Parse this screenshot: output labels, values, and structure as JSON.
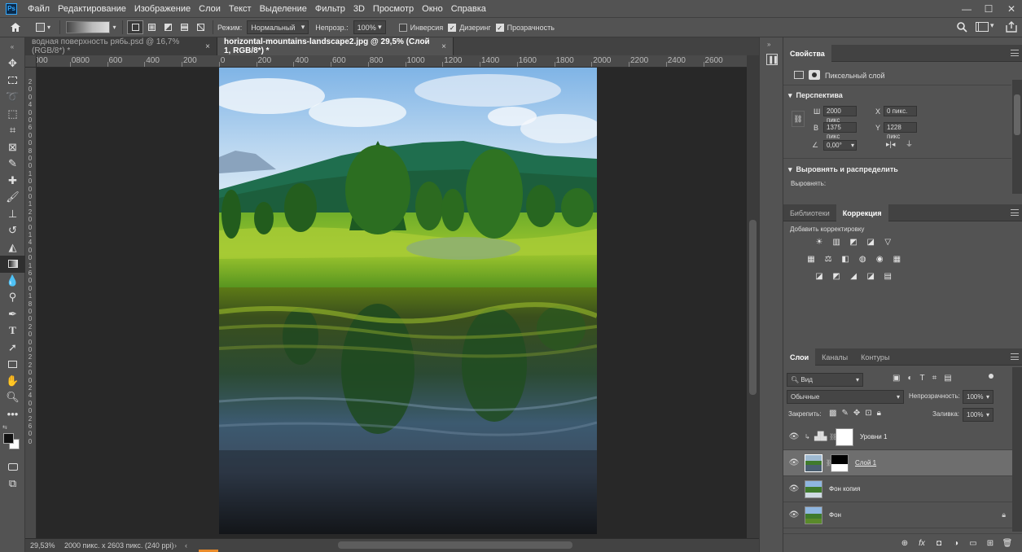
{
  "app": {
    "logo_text": "Ps"
  },
  "menu": [
    "Файл",
    "Редактирование",
    "Изображение",
    "Слои",
    "Текст",
    "Выделение",
    "Фильтр",
    "3D",
    "Просмотр",
    "Окно",
    "Справка"
  ],
  "window_controls": {
    "minimize": "—",
    "maximize": "☐",
    "close": "✕"
  },
  "options": {
    "mode_label": "Режим:",
    "mode_value": "Нормальный",
    "opacity_label": "Непрозр.:",
    "opacity_value": "100%",
    "inverse_label": "Инверсия",
    "dither_label": "Дизеринг",
    "transparency_label": "Прозрачность"
  },
  "tabs": [
    {
      "label": "водная поверхность рябь.psd @ 16,7% (RGB/8*) *",
      "close": "×"
    },
    {
      "label": "horizontal-mountains-landscape2.jpg @ 29,5% (Слой 1, RGB/8*) *",
      "close": "×"
    }
  ],
  "ruler": {
    "h_ticks": [
      "000",
      "0800",
      "600",
      "400",
      "200",
      "0",
      "200",
      "400",
      "600",
      "800",
      "1000",
      "1200",
      "1400",
      "1600",
      "1800",
      "2000",
      "2200",
      "2400",
      "2600"
    ],
    "v_ticks": [
      "2",
      "0",
      "0",
      "4",
      "0",
      "0",
      "6",
      "0",
      "0",
      "8",
      "0",
      "0",
      "1",
      "0",
      "0",
      "0",
      "1",
      "2",
      "0",
      "0",
      "1",
      "4",
      "0",
      "0",
      "1",
      "6",
      "0",
      "0",
      "1",
      "8",
      "0",
      "0",
      "2",
      "0",
      "0",
      "0",
      "2",
      "2",
      "0",
      "0",
      "2",
      "4",
      "0",
      "0",
      "2",
      "6",
      "0",
      "0"
    ]
  },
  "status": {
    "zoom": "29,53%",
    "doc_info": "2000 пикс. x 2603 пикс. (240 ppi)"
  },
  "properties": {
    "tab": "Свойства",
    "layer_type": "Пиксельный слой",
    "section_perspective": "Перспектива",
    "w_label": "Ш",
    "w_value": "2000 пикс",
    "h_label": "В",
    "h_value": "1375 пикс",
    "x_label": "X",
    "x_value": "0 пикс.",
    "y_label": "Y",
    "y_value": "1228 пикс",
    "angle_value": "0,00°",
    "section_align": "Выровнять и распределить",
    "align_label": "Выровнять:"
  },
  "adjust": {
    "tabs": [
      "Библиотеки",
      "Коррекция"
    ],
    "add_label": "Добавить корректировку",
    "row1": [
      "☀",
      "▥",
      "◩",
      "◪",
      "▽"
    ],
    "row2": [
      "▦",
      "⚖",
      "◧",
      "◍",
      "◉",
      "▦"
    ],
    "row3": [
      "◪",
      "◩",
      "◢",
      "◪",
      "▤"
    ]
  },
  "layers_panel": {
    "tabs": [
      "Слои",
      "Каналы",
      "Контуры"
    ],
    "filter_value": "Вид",
    "blend_value": "Обычные",
    "opacity_label": "Непрозрачность:",
    "opacity_value": "100%",
    "lock_label": "Закрепить:",
    "fill_label": "Заливка:",
    "fill_value": "100%",
    "layers": [
      {
        "name": "Уровни 1"
      },
      {
        "name": "Слой 1"
      },
      {
        "name": "Фон копия"
      },
      {
        "name": "Фон"
      }
    ],
    "footer_icons": [
      "⊕",
      "fx",
      "◘",
      "◑",
      "▭",
      "⊞",
      "🗑"
    ]
  }
}
